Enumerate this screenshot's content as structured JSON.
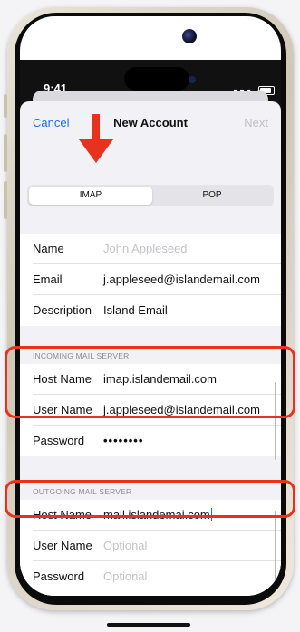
{
  "status": {
    "time": "9:41"
  },
  "nav": {
    "cancel": "Cancel",
    "title": "New Account",
    "next": "Next"
  },
  "segments": {
    "imap": "IMAP",
    "pop": "POP",
    "selected": "IMAP"
  },
  "account": {
    "name_label": "Name",
    "name_placeholder": "John Appleseed",
    "email_label": "Email",
    "email_value": "j.appleseed@islandemail.com",
    "description_label": "Description",
    "description_value": "Island Email"
  },
  "incoming": {
    "header": "INCOMING MAIL SERVER",
    "host_label": "Host Name",
    "host_value": "imap.islandemail.com",
    "user_label": "User Name",
    "user_value": "j.appleseed@islandemail.com",
    "password_label": "Password",
    "password_value": "••••••••"
  },
  "outgoing": {
    "header": "OUTGOING MAIL SERVER",
    "host_label": "Host Name",
    "host_value": "mail.islandemai.com",
    "user_label": "User Name",
    "user_placeholder": "Optional",
    "password_label": "Password",
    "password_placeholder": "Optional"
  },
  "colors": {
    "accent": "#1e6ee6",
    "highlight": "#e8321e"
  },
  "icons": {
    "annotation": "down-arrow-icon"
  }
}
